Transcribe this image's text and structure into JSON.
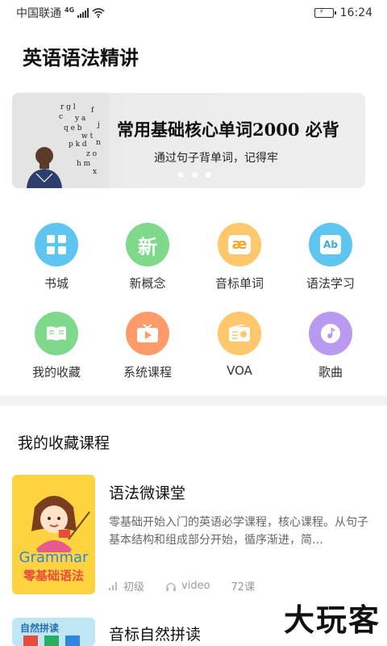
{
  "status": {
    "carrier": "中国联通",
    "network": "4G",
    "time": "16:24"
  },
  "app": {
    "title": "英语语法精讲"
  },
  "banner": {
    "title": "常用基础核心单词2000 必背",
    "subtitle": "通过句子背单词，记得牢",
    "dots": 3,
    "active_dot": 2
  },
  "grid": [
    {
      "label": "书城",
      "icon": "grid-icon",
      "color": "#5ec4f0"
    },
    {
      "label": "新概念",
      "icon": "xin-icon",
      "color": "#7fd98a",
      "glyph": "新"
    },
    {
      "label": "音标单词",
      "icon": "phonetic-ae-icon",
      "color": "#ffc76b",
      "glyph": "æ"
    },
    {
      "label": "语法学习",
      "icon": "ab-book-icon",
      "color": "#5ec4f0",
      "glyph": "Ab"
    },
    {
      "label": "我的收藏",
      "icon": "open-book-icon",
      "color": "#7fd98a"
    },
    {
      "label": "系统课程",
      "icon": "play-tv-icon",
      "color": "#ff9a6a"
    },
    {
      "label": "VOA",
      "icon": "radio-icon",
      "color": "#ffc76b"
    },
    {
      "label": "歌曲",
      "icon": "music-disc-icon",
      "color": "#b89af0"
    }
  ],
  "favorites": {
    "section_title": "我的收藏课程",
    "courses": [
      {
        "title": "语法微课堂",
        "description": "零基础开始入门的英语必学课程，核心课程。从句子基本结构和组成部分开始，循序渐进，简…",
        "level": "初级",
        "type": "video",
        "lessons": "72课",
        "cover": {
          "line1": "Grammar",
          "line2": "零基础语法"
        }
      },
      {
        "title": "音标自然拼读",
        "cover": {
          "line1": "自然拼读"
        }
      }
    ]
  },
  "watermark": "大玩客"
}
